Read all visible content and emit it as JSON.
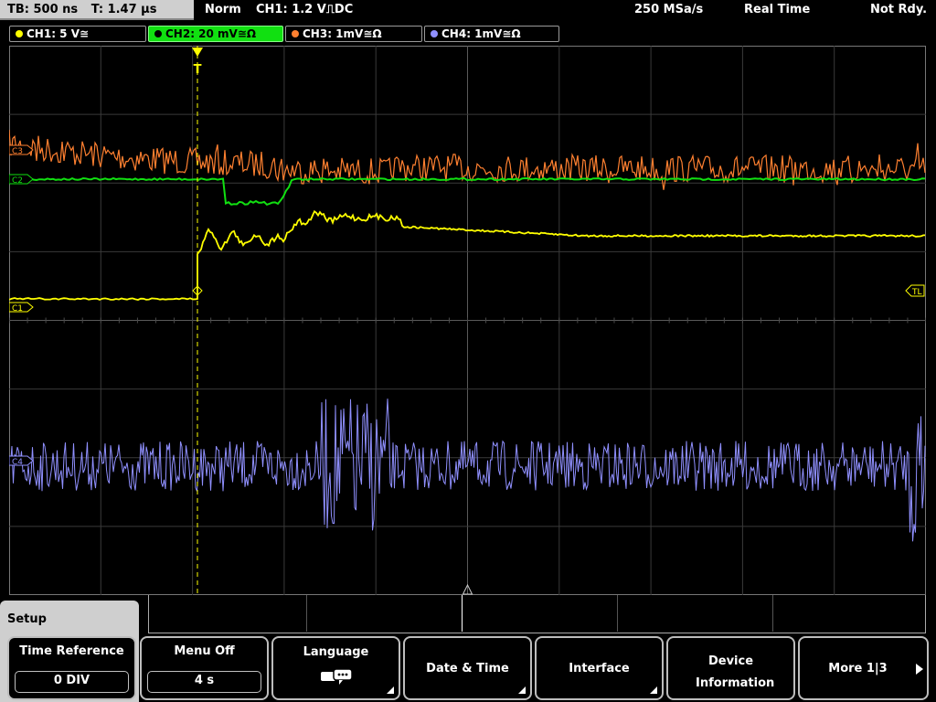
{
  "top": {
    "timebase": "TB: 500 ns",
    "trigger_time": "T: 1.47 µs",
    "mode": "Norm",
    "trigger": "CH1: 1.2 V",
    "trigger_coupling": "DC",
    "sample_rate": "250 MSa/s",
    "acquisition": "Real Time",
    "state": "Not Rdy."
  },
  "channels": [
    {
      "label": "CH1: 5 V≅",
      "color": "#ffff00",
      "active": false
    },
    {
      "label": "CH2: 20 mV≅Ω",
      "color": "#11e011",
      "active": true
    },
    {
      "label": "CH3: 1mV≅Ω",
      "color": "#ff8030",
      "active": false
    },
    {
      "label": "CH4: 1mV≅Ω",
      "color": "#9090ff",
      "active": false
    }
  ],
  "markers": {
    "c1": "C1",
    "c2": "C2",
    "c3": "C3",
    "c4": "C4",
    "trigger_level": "TL",
    "trigger_pos": "T"
  },
  "menu": {
    "title": "Setup",
    "keys": [
      {
        "label": "Time Reference",
        "value": "0 DIV"
      },
      {
        "label": "Menu Off",
        "value": "4 s"
      },
      {
        "label": "Language",
        "icon": "speech-bubbles-icon"
      },
      {
        "label": "Date & Time"
      },
      {
        "label": "Interface"
      },
      {
        "label": "Device Information"
      },
      {
        "label": "More 1|3"
      }
    ]
  }
}
